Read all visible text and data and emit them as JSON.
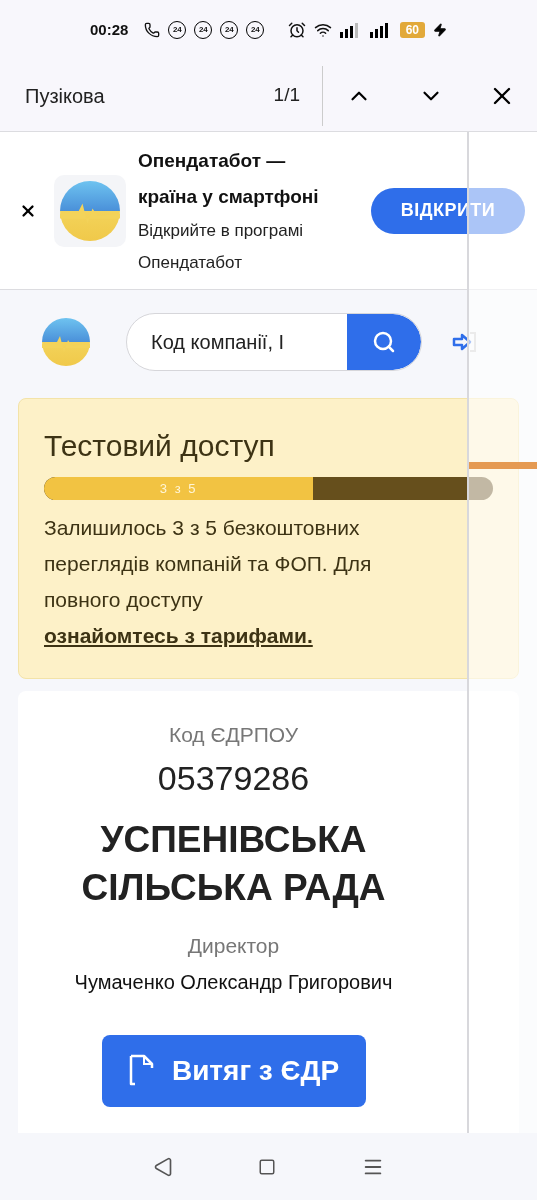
{
  "status_bar": {
    "time": "00:28",
    "notification_badges": [
      "24",
      "24",
      "24",
      "24"
    ],
    "battery": "60"
  },
  "find_bar": {
    "query": "Пузікова",
    "count": "1/1"
  },
  "app_banner": {
    "title": "Опендатабот — країна у смартфоні",
    "subtitle": "Відкрийте в програмі Опендатабот",
    "button": "ВІДКРИТИ"
  },
  "search": {
    "placeholder": "Код компанії, І"
  },
  "trial": {
    "title": "Тестовий доступ",
    "progress_label": "3 з 5",
    "level": 0.6,
    "message": "Залишилось 3 з 5 безкоштовних переглядів компаній та ФОП. Для повного доступу ",
    "link": "ознайомтесь з тарифами."
  },
  "company": {
    "code_label": "Код ЄДРПОУ",
    "code": "05379286",
    "name": "УСПЕНІВСЬКА СІЛЬСЬКА РАДА",
    "role_label": "Директор",
    "director": "Чумаченко Олександр Григорович",
    "extract_button": "Витяг з ЄДР"
  }
}
